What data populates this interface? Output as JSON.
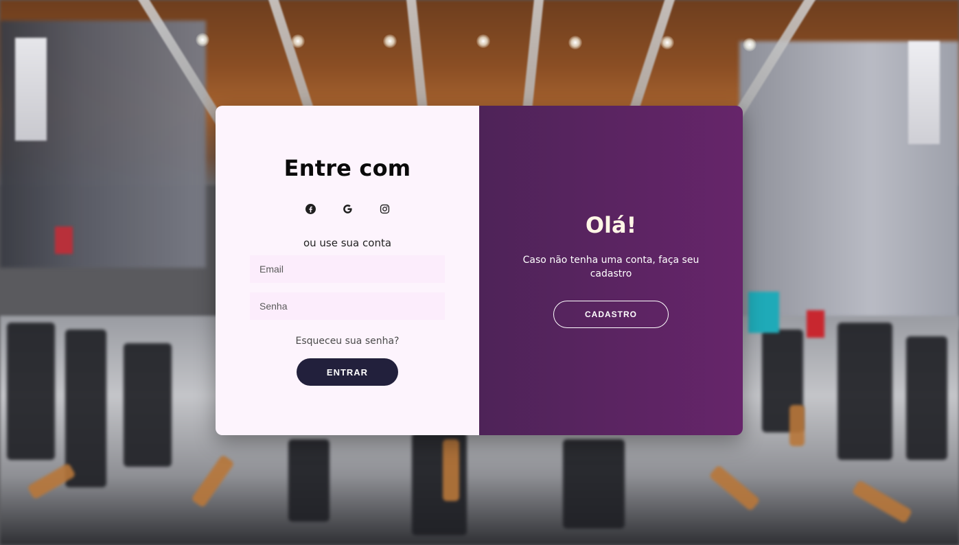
{
  "login": {
    "title": "Entre com",
    "social_icons": [
      "facebook-icon",
      "google-icon",
      "instagram-icon"
    ],
    "subtitle": "ou use sua conta",
    "email_placeholder": "Email",
    "password_placeholder": "Senha",
    "forgot_password": "Esqueceu sua senha?",
    "submit_label": "ENTRAR"
  },
  "signup_panel": {
    "title": "Olá!",
    "text": "Caso não tenha uma conta, faça seu cadastro",
    "button_label": "CADASTRO"
  },
  "colors": {
    "left_panel_bg": "#fdf4fd",
    "right_panel_bg": "#66256a",
    "enter_button": "#22203c",
    "input_bg": "#fcedfc"
  }
}
